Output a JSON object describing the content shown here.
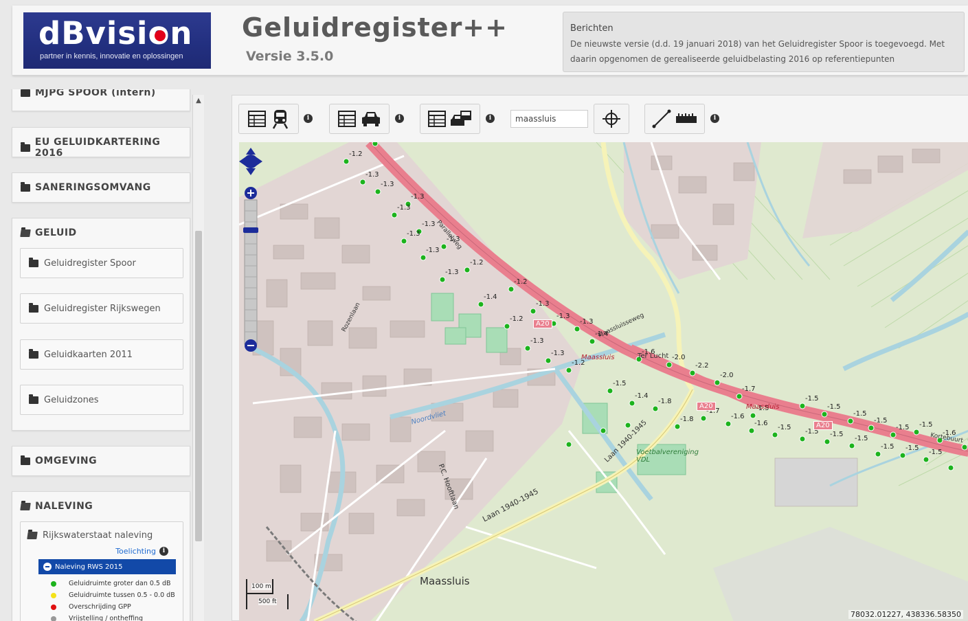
{
  "header": {
    "logo_text": "dBvision",
    "logo_tagline": "partner in kennis, innovatie en oplossingen",
    "app_title": "Geluidregister++",
    "version": "Versie 3.5.0",
    "messages_title": "Berichten",
    "messages_body": "De nieuwste versie (d.d. 19 januari 2018) van het Geluidregister Spoor is toegevoegd. Met daarin opgenomen de gerealiseerde geluidbelasting 2016 op referentiepunten"
  },
  "sidebar": {
    "panels": {
      "mjpg": "MJPG SPOOR (intern)",
      "eu": "EU GELUIDKARTERING 2016",
      "sanering": "SANERINGSOMVANG",
      "geluid": "GELUID",
      "omgeving": "OMGEVING",
      "naleving": "NALEVING"
    },
    "geluid_items": [
      "Geluidregister Spoor",
      "Geluidregister Rijkswegen",
      "Geluidkaarten 2011",
      "Geluidzones"
    ],
    "naleving_sub": "Rijkswaterstaat naleving",
    "toelichting": "Toelichting",
    "active_layer": "Naleving RWS 2015",
    "legend": [
      {
        "label": "Geluidruimte groter dan 0.5 dB",
        "color": "#1db31d"
      },
      {
        "label": "Geluidruimte tussen 0.5 - 0.0 dB",
        "color": "#f4e21a"
      },
      {
        "label": "Overschrijding GPP",
        "color": "#e01010"
      },
      {
        "label": "Vrijstelling / ontheffing",
        "color": "#999999"
      }
    ]
  },
  "toolbar": {
    "search_value": "maassluis",
    "info_symbol": "i"
  },
  "map": {
    "coords": "78032.01227, 438336.58350",
    "scale_m": "100 m",
    "scale_ft": "500 ft",
    "places": {
      "maassluis": "Maassluis",
      "maassluis_small": "Maassluis",
      "maassluis_hwy": "Maassluis",
      "a20": "A20",
      "vdl": "Voetbalvereniging VDL",
      "laan": "Laan 1940-1945",
      "parallelweg": "Parallelweg",
      "noordvliet": "Noordvliet",
      "hoogstraat": "P.C. Hooftlaan",
      "rozenlaan": "Rozenlaan",
      "kortebuurt": "Kortebuurt",
      "korte_luchtt": "Ter Lucht",
      "oost": "Maassluisseweg"
    },
    "noise_labels": [
      "-1.2",
      "-1.4",
      "-1.3",
      "-1.3",
      "-1.3",
      "-1.3",
      "-1.3",
      "-1.3",
      "-1.3",
      "-1.3",
      "-1.3",
      "-1.2",
      "-1.4",
      "-1.2",
      "-1.2",
      "-1.3",
      "-1.3",
      "-1.3",
      "-1.3",
      "-1.3",
      "-1.2",
      "-1.4",
      "-1.5",
      "-1.4",
      "-1.6",
      "-2.0",
      "-2.2",
      "-2.0",
      "-1.7",
      "-1.5",
      "-1.5",
      "-1.5",
      "-1.5",
      "-1.5",
      "-1.5",
      "-1.5",
      "-1.6",
      "-1.7",
      "-1.8",
      "-1.8",
      "-1.7",
      "-1.6",
      "-1.6",
      "-1.5",
      "-1.5",
      "-1.5",
      "-1.5",
      "-1.5",
      "-1.5",
      "-1.5"
    ]
  }
}
